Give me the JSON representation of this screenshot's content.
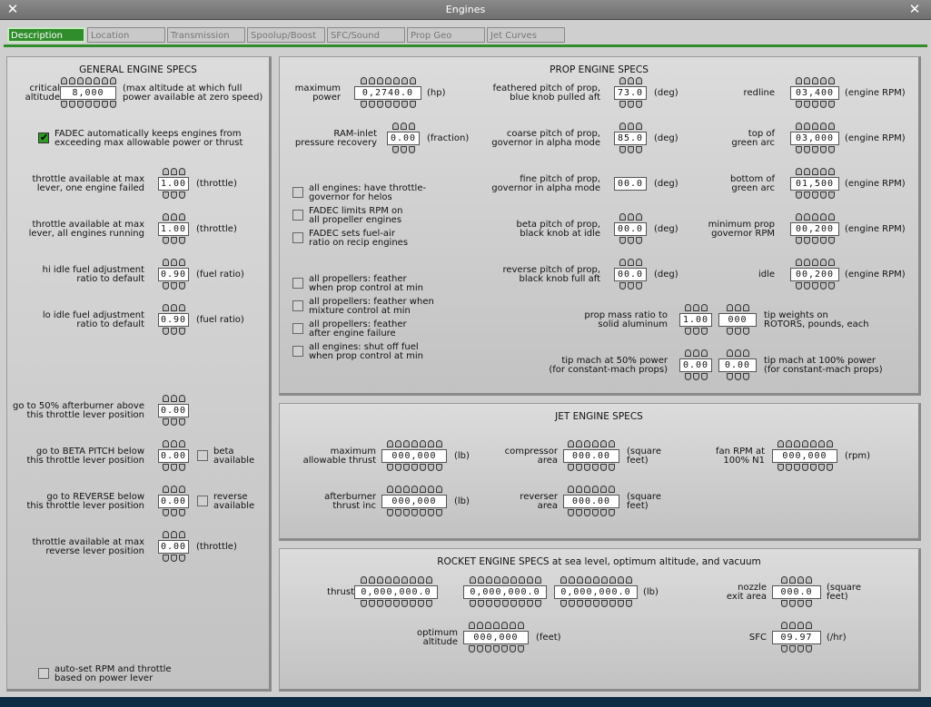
{
  "window": {
    "title": "Engines",
    "close_left": "✕",
    "close_right": "✕"
  },
  "tabs": [
    {
      "label": "Description",
      "active": true
    },
    {
      "label": "Location"
    },
    {
      "label": "Transmission"
    },
    {
      "label": "Spoolup/Boost"
    },
    {
      "label": "SFC/Sound"
    },
    {
      "label": "Prop Geo"
    },
    {
      "label": "Jet Curves"
    }
  ],
  "general": {
    "title": "GENERAL ENGINE SPECS",
    "critical_altitude": {
      "label": "critical\naltitude",
      "value": "8,000",
      "unit": "(max altitude at which full\npower available at zero speed)"
    },
    "fadec_power": {
      "label": "FADEC automatically keeps engines from\nexceeding max allowable power or thrust",
      "checked": true
    },
    "throttle_one_failed": {
      "label": "throttle available at max\nlever, one engine failed",
      "value": "1.00",
      "unit": "(throttle)"
    },
    "throttle_all_running": {
      "label": "throttle available at max\nlever, all engines running",
      "value": "1.00",
      "unit": "(throttle)"
    },
    "hi_idle": {
      "label": "hi idle fuel adjustment\nratio to default",
      "value": "0.90",
      "unit": "(fuel ratio)"
    },
    "lo_idle": {
      "label": "lo idle fuel adjustment\nratio to default",
      "value": "0.90",
      "unit": "(fuel ratio)"
    },
    "afterburner_50": {
      "label": "go to 50% afterburner above\nthis throttle lever position",
      "value": "0.00"
    },
    "beta_pitch": {
      "label": "go to BETA PITCH below\nthis throttle lever position",
      "value": "0.00",
      "check_label": "beta\navailable",
      "checked": false
    },
    "reverse": {
      "label": "go to REVERSE below\nthis throttle lever position",
      "value": "0.00",
      "check_label": "reverse\navailable",
      "checked": false
    },
    "throttle_reverse": {
      "label": "throttle available at max\nreverse lever position",
      "value": "0.00",
      "unit": "(throttle)"
    },
    "auto_set": {
      "label": "auto-set RPM and throttle\nbased on power lever",
      "checked": false
    }
  },
  "prop": {
    "title": "PROP ENGINE SPECS",
    "max_power": {
      "label": "maximum\npower",
      "value": "0,2740.0",
      "unit": "(hp)"
    },
    "ram_inlet": {
      "label": "RAM-inlet\npressure recovery",
      "value": "0.00",
      "unit": "(fraction)"
    },
    "checks": [
      {
        "label": "all engines: have throttle-\ngovernor for helos",
        "checked": false
      },
      {
        "label": "FADEC limits RPM on\nall propeller engines",
        "checked": false
      },
      {
        "label": "FADEC sets fuel-air\nratio on recip engines",
        "checked": false
      },
      {
        "label": "all propellers: feather\nwhen prop control at min",
        "checked": false
      },
      {
        "label": "all propellers: feather when\nmixture control at min",
        "checked": false
      },
      {
        "label": "all propellers: feather\nafter engine failure",
        "checked": false
      },
      {
        "label": "all engines: shut off fuel\nwhen prop control at min",
        "checked": false
      }
    ],
    "feathered": {
      "label": "feathered pitch of prop,\nblue knob pulled aft",
      "value": "73.0",
      "unit": "(deg)"
    },
    "coarse": {
      "label": "coarse pitch of prop,\ngovernor in alpha mode",
      "value": "85.0",
      "unit": "(deg)"
    },
    "fine": {
      "label": "fine pitch of prop,\ngovernor in alpha mode",
      "value": "00.0",
      "unit": "(deg)"
    },
    "beta": {
      "label": "beta pitch of prop,\nblack knob at idle",
      "value": "00.0",
      "unit": "(deg)"
    },
    "reverse_pitch": {
      "label": "reverse pitch of prop,\nblack knob full aft",
      "value": "00.0",
      "unit": "(deg)"
    },
    "redline": {
      "label": "redline",
      "value": "03,400",
      "unit": "(engine RPM)"
    },
    "top_green": {
      "label": "top of\ngreen arc",
      "value": "03,000",
      "unit": "(engine RPM)"
    },
    "bottom_green": {
      "label": "bottom of\ngreen arc",
      "value": "01,500",
      "unit": "(engine RPM)"
    },
    "min_gov": {
      "label": "minimum prop\ngovernor RPM",
      "value": "00,200",
      "unit": "(engine RPM)"
    },
    "idle": {
      "label": "idle",
      "value": "00,200",
      "unit": "(engine RPM)"
    },
    "mass_ratio": {
      "label": "prop mass ratio to\nsolid aluminum",
      "value": "1.00",
      "value2": "000",
      "unit": "tip weights on\nROTORS, pounds, each"
    },
    "tip_mach": {
      "label": "tip mach at 50% power\n(for constant-mach props)",
      "value": "0.00",
      "value2": "0.00",
      "unit": "tip mach at 100% power\n(for constant-mach props)"
    }
  },
  "jet": {
    "title": "JET ENGINE SPECS",
    "max_thrust": {
      "label": "maximum\nallowable thrust",
      "value": "000,000",
      "unit": "(lb)"
    },
    "ab_thrust": {
      "label": "afterburner\nthrust inc",
      "value": "000,000",
      "unit": "(lb)"
    },
    "compressor": {
      "label": "compressor\narea",
      "value": "000.00",
      "unit": "(square\nfeet)"
    },
    "reverser": {
      "label": "reverser\narea",
      "value": "000.00",
      "unit": "(square\nfeet)"
    },
    "fan_rpm": {
      "label": "fan RPM at\n100% N1",
      "value": "000,000",
      "unit": "(rpm)"
    }
  },
  "rocket": {
    "title": "ROCKET ENGINE SPECS at sea level, optimum altitude, and vacuum",
    "thrust": {
      "label": "thrust",
      "v1": "0,000,000.0",
      "v2": "0,000,000.0",
      "v3": "0,000,000.0",
      "unit": "(lb)"
    },
    "opt_alt": {
      "label": "optimum\naltitude",
      "value": "000,000",
      "unit": "(feet)"
    },
    "nozzle": {
      "label": "nozzle\nexit area",
      "value": "000.0",
      "unit": "(square\nfeet)"
    },
    "sfc": {
      "label": "SFC",
      "value": "09.97",
      "unit": "(/hr)"
    }
  }
}
